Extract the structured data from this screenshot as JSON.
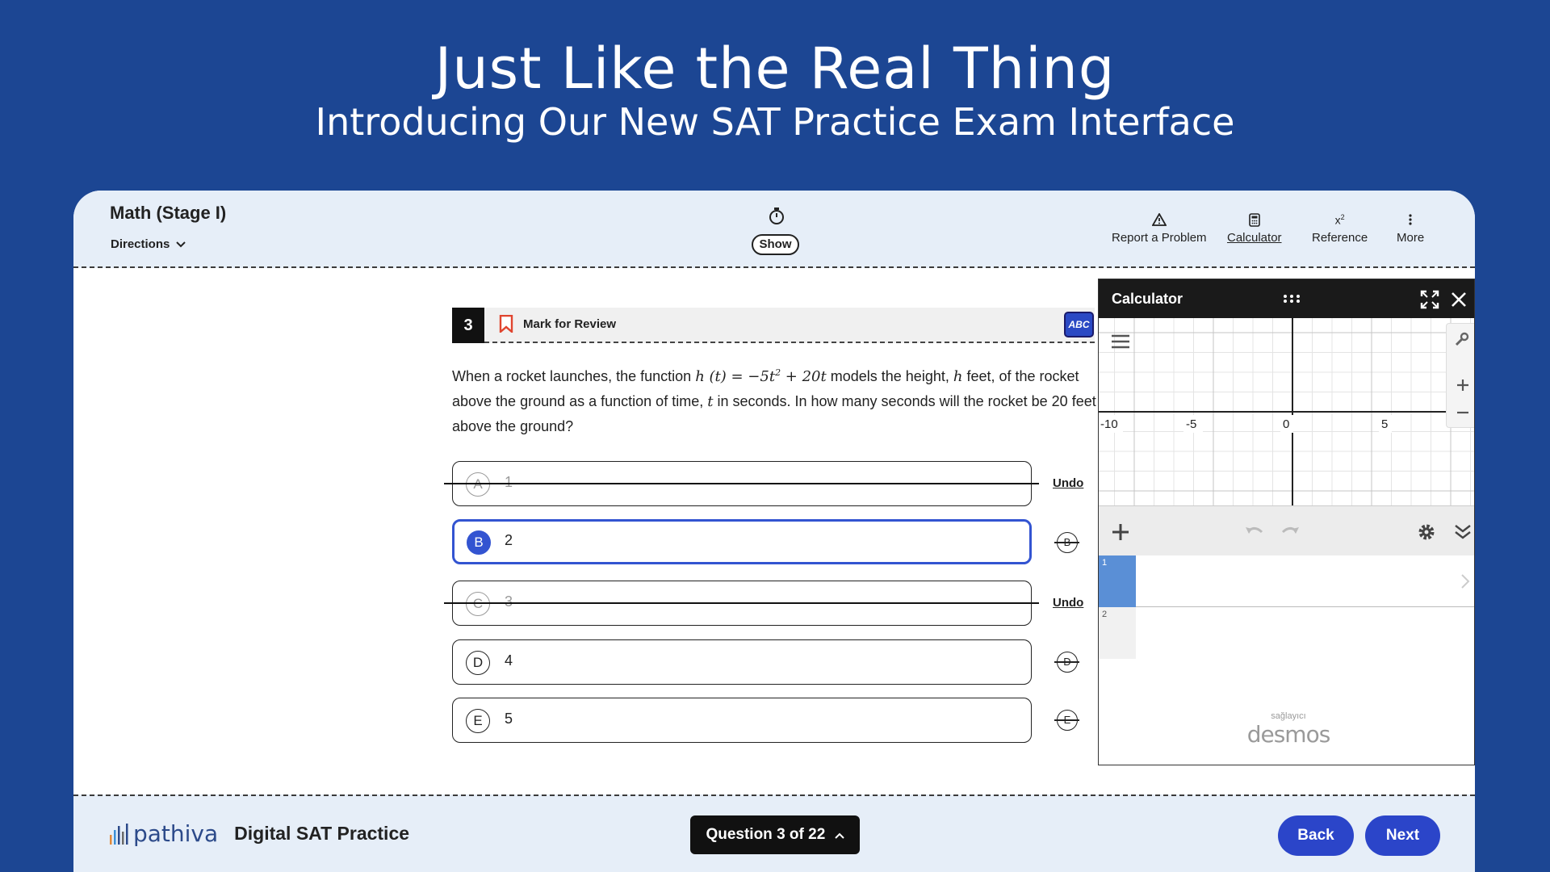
{
  "promo": {
    "title": "Just Like the Real Thing",
    "subtitle": "Introducing Our New SAT Practice Exam Interface"
  },
  "header": {
    "section_title": "Math (Stage I)",
    "directions_label": "Directions",
    "timer_toggle_label": "Show",
    "tools": [
      {
        "label": "Report a Problem",
        "icon": "warning-triangle-icon"
      },
      {
        "label": "Calculator",
        "icon": "calculator-icon",
        "active": true
      },
      {
        "label": "Reference",
        "icon": "x-squared-icon"
      },
      {
        "label": "More",
        "icon": "vertical-dots-icon"
      }
    ]
  },
  "question": {
    "number": "3",
    "mark_for_review_label": "Mark for Review",
    "abc_label": "ABC",
    "text_1": "When a rocket launches, the function ",
    "text_2": " models the height, ",
    "text_3": " feet, of the rocket above the ground as a function of time, ",
    "text_4": " in seconds. In how many seconds will the rocket be 20 feet above the ground?",
    "var_h": "h",
    "var_t": "t",
    "formula_pre": "h (t) = −5t",
    "formula_exp": "2",
    "formula_post": " + 20t"
  },
  "choices": [
    {
      "letter": "A",
      "value": "1",
      "state": "eliminated",
      "action_label": "Undo"
    },
    {
      "letter": "B",
      "value": "2",
      "state": "selected"
    },
    {
      "letter": "C",
      "value": "3",
      "state": "eliminated",
      "action_label": "Undo"
    },
    {
      "letter": "D",
      "value": "4",
      "state": "normal"
    },
    {
      "letter": "E",
      "value": "5",
      "state": "normal"
    }
  ],
  "calculator": {
    "title": "Calculator",
    "x_ticks": [
      "-10",
      "-5",
      "0",
      "5"
    ],
    "expression_rows": [
      "1",
      "2"
    ],
    "provider_small": "sağlayıcı",
    "provider_name": "desmos"
  },
  "footer": {
    "brand_name": "pathiva",
    "brand_subtitle": "Digital SAT Practice",
    "question_nav_label": "Question 3 of 22",
    "back_label": "Back",
    "next_label": "Next"
  },
  "colors": {
    "page_background": "#1c4693",
    "accent_blue": "#2b45c9",
    "bookmark_red": "#e0452f"
  }
}
